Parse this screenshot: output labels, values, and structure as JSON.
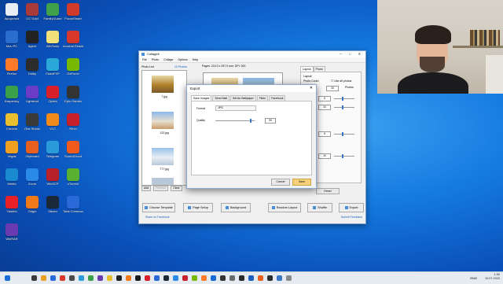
{
  "desktop": {
    "icons": [
      {
        "label": "Ακοματικά",
        "color": "#e9eef5"
      },
      {
        "label": "CC Gold",
        "color": "#a83a3a"
      },
      {
        "label": "FamilyGuard",
        "color": "#3fa24a"
      },
      {
        "label": "FocusSmart",
        "color": "#d23a2a"
      },
      {
        "label": "Μου PC",
        "color": "#2a6fd0"
      },
      {
        "label": "Agent",
        "color": "#222222"
      },
      {
        "label": "WinTools",
        "color": "#f2e07a"
      },
      {
        "label": "Acrobat Reader",
        "color": "#d8382a"
      },
      {
        "label": "Firefox",
        "color": "#ff7b2a"
      },
      {
        "label": "Dolby",
        "color": "#2c2c2c"
      },
      {
        "label": "FlashFXP",
        "color": "#2aa8d8"
      },
      {
        "label": "GeForce",
        "color": "#76b900"
      },
      {
        "label": "Kaspersky",
        "color": "#3aa04a"
      },
      {
        "label": "Lightshot",
        "color": "#6b3cc8"
      },
      {
        "label": "Opera",
        "color": "#d8202a"
      },
      {
        "label": "Epic Games",
        "color": "#333333"
      },
      {
        "label": "Chrome",
        "color": "#e8c030"
      },
      {
        "label": "Obs Studio",
        "color": "#3a3a3a"
      },
      {
        "label": "VLC",
        "color": "#f08a1a"
      },
      {
        "label": "Revo",
        "color": "#c8202a"
      },
      {
        "label": "Vegas",
        "color": "#f0a020"
      },
      {
        "label": "Clipboard",
        "color": "#e86020"
      },
      {
        "label": "Telegram",
        "color": "#2a9ad8"
      },
      {
        "label": "SoundCloud",
        "color": "#f05a1a"
      },
      {
        "label": "Media",
        "color": "#1a8ad0"
      },
      {
        "label": "Zoom",
        "color": "#2a8ae8"
      },
      {
        "label": "WinSCP",
        "color": "#b8202a"
      },
      {
        "label": "uTorrent",
        "color": "#5ab030"
      },
      {
        "label": "Yandex",
        "color": "#e8202a"
      },
      {
        "label": "Origin",
        "color": "#f07a1a"
      },
      {
        "label": "Steam",
        "color": "#1b2838"
      },
      {
        "label": "Total Commander",
        "color": "#2a6ad8"
      },
      {
        "label": "WinRAR",
        "color": "#6a3ab0"
      }
    ]
  },
  "app": {
    "title": "Collagelt",
    "menu": [
      "File",
      "Photo",
      "Collage",
      "Options",
      "Help"
    ],
    "photo_list": {
      "header": "Photo List",
      "count": "10 Photos",
      "items": [
        {
          "name": "7.jpg",
          "color": "#c8a050"
        },
        {
          "name": "123.jpg",
          "color": "#5a8ad0"
        },
        {
          "name": "777.jpg",
          "color": "#6a9ad8"
        }
      ],
      "buttons": {
        "add": "Add",
        "remove": "Remove",
        "clear": "Clear"
      }
    },
    "canvas_info": "Pages: 210.0 x 297.0 mm, DPI: 300",
    "right_tabs": [
      "Layout",
      "Photo"
    ],
    "layout": {
      "label": "Layout",
      "photo_count_label": "Photo Count",
      "use_all": "Use all photos",
      "photos_label": "Photos",
      "photos_value": "30",
      "spin1": "6",
      "spin2": "33",
      "spin3": "5",
      "spin4": "10"
    },
    "reset": "Reset",
    "bottom": {
      "template": "Choose Template",
      "page_setup": "Page Setup",
      "background": "Background",
      "random_layout": "Random Layout",
      "shuffle": "Shuffle",
      "export": "Export"
    },
    "footer": {
      "share": "Share on Facebook",
      "feedback": "Submit Feedback"
    }
  },
  "dialog": {
    "title": "Export",
    "tabs": [
      "Save Images",
      "Send Mail",
      "Set As Wallpaper",
      "Flickr",
      "Facebook"
    ],
    "format_label": "Format",
    "format_value": "JPG",
    "quality_label": "Quality",
    "quality_value": "90",
    "quality": 0.9,
    "cancel": "Cancel",
    "save": "Save"
  },
  "taskbar": {
    "time": "1:50",
    "date": "10.07.2020",
    "lang": "ENG"
  }
}
